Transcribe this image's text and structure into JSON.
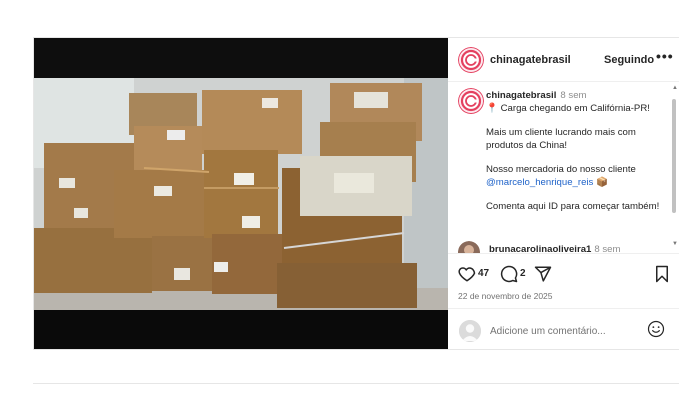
{
  "post": {
    "username": "chinagatebrasil",
    "follow_label": "Seguindo",
    "more_label": "•••",
    "media": {
      "description": "stack of cardboard shipping boxes"
    },
    "caption": {
      "username": "chinagatebrasil",
      "time": "8 sem",
      "line1": "📍 Carga chegando em Califórnia-PR!",
      "line2": "Mais um cliente lucrando mais com produtos da China!",
      "line3_prefix": "Nosso mercadoria do nosso cliente",
      "mention": "@marcelo_henrique_reis",
      "line3_suffix": " 📦",
      "line4": "Comenta aqui ID para começar também!"
    },
    "comment2": {
      "username": "brunacarolinaoliveira1",
      "time": "8 sem"
    },
    "likes": "47",
    "comments_count": "2",
    "date": "22 de novembro de 2025",
    "add_comment_placeholder": "Adicione um comentário...",
    "icons": {
      "more": "more-dots-icon",
      "like": "heart-icon",
      "comment": "comment-bubble-icon",
      "share": "paper-plane-icon",
      "save": "bookmark-icon",
      "emoji": "smiley-icon",
      "avatar": "chinagate-logo-icon"
    },
    "colors": {
      "brand": "#e4405f",
      "mention": "#1f63c9",
      "muted": "#8e8e8e"
    }
  }
}
